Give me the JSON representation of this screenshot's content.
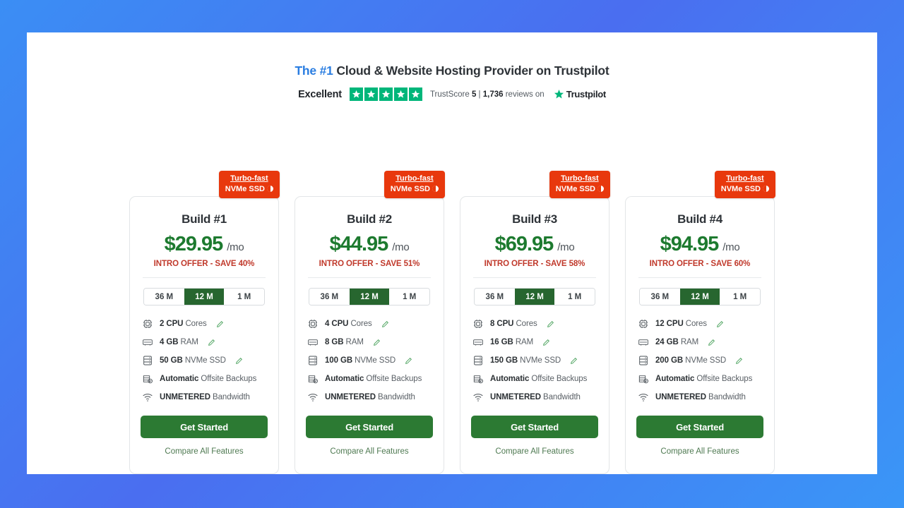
{
  "header": {
    "title_highlight": "The #1",
    "title_rest": " Cloud & Website Hosting Provider on Trustpilot",
    "rating_word": "Excellent",
    "stars": 5,
    "star_color": "#00b67a",
    "trustscore_prefix": "TrustScore ",
    "trustscore_value": "5",
    "separator": " | ",
    "reviews_count": "1,736",
    "reviews_suffix": " reviews on",
    "brand": "Trustpilot"
  },
  "badge": {
    "line1": "Turbo-fast",
    "line2": "NVMe SSD",
    "info_icon": "info-icon",
    "color": "#e8380d"
  },
  "terms": [
    "36 M",
    "12 M",
    "1 M"
  ],
  "selected_term": "12 M",
  "labels": {
    "per_month": "/mo",
    "cta": "Get Started",
    "compare": "Compare All Features"
  },
  "colors": {
    "price": "#1d7a2f",
    "intro": "#c0392b",
    "cta": "#2c7a33",
    "accent_blue": "#2a7de1"
  },
  "plans": [
    {
      "title": "Build #1",
      "price": "$29.95",
      "intro": "INTRO OFFER - SAVE 40%",
      "features": [
        {
          "icon": "cpu-icon",
          "strong": "2 CPU",
          "rest": " Cores",
          "editable": true
        },
        {
          "icon": "ram-icon",
          "strong": "4 GB",
          "rest": " RAM",
          "editable": true
        },
        {
          "icon": "ssd-icon",
          "strong": "50 GB",
          "rest": " NVMe SSD",
          "editable": true
        },
        {
          "icon": "backup-icon",
          "strong": "Automatic",
          "rest": " Offsite Backups",
          "editable": false
        },
        {
          "icon": "bandwidth-icon",
          "strong": "UNMETERED",
          "rest": " Bandwidth",
          "editable": false
        }
      ]
    },
    {
      "title": "Build #2",
      "price": "$44.95",
      "intro": "INTRO OFFER - SAVE 51%",
      "features": [
        {
          "icon": "cpu-icon",
          "strong": "4 CPU",
          "rest": " Cores",
          "editable": true
        },
        {
          "icon": "ram-icon",
          "strong": "8 GB",
          "rest": " RAM",
          "editable": true
        },
        {
          "icon": "ssd-icon",
          "strong": "100 GB",
          "rest": " NVMe SSD",
          "editable": true
        },
        {
          "icon": "backup-icon",
          "strong": "Automatic",
          "rest": " Offsite Backups",
          "editable": false
        },
        {
          "icon": "bandwidth-icon",
          "strong": "UNMETERED",
          "rest": " Bandwidth",
          "editable": false
        }
      ]
    },
    {
      "title": "Build #3",
      "price": "$69.95",
      "intro": "INTRO OFFER - SAVE 58%",
      "features": [
        {
          "icon": "cpu-icon",
          "strong": "8 CPU",
          "rest": " Cores",
          "editable": true
        },
        {
          "icon": "ram-icon",
          "strong": "16 GB",
          "rest": " RAM",
          "editable": true
        },
        {
          "icon": "ssd-icon",
          "strong": "150 GB",
          "rest": " NVMe SSD",
          "editable": true
        },
        {
          "icon": "backup-icon",
          "strong": "Automatic",
          "rest": " Offsite Backups",
          "editable": false
        },
        {
          "icon": "bandwidth-icon",
          "strong": "UNMETERED",
          "rest": " Bandwidth",
          "editable": false
        }
      ]
    },
    {
      "title": "Build #4",
      "price": "$94.95",
      "intro": "INTRO OFFER - SAVE 60%",
      "features": [
        {
          "icon": "cpu-icon",
          "strong": "12 CPU",
          "rest": " Cores",
          "editable": true
        },
        {
          "icon": "ram-icon",
          "strong": "24 GB",
          "rest": " RAM",
          "editable": true
        },
        {
          "icon": "ssd-icon",
          "strong": "200 GB",
          "rest": " NVMe SSD",
          "editable": true
        },
        {
          "icon": "backup-icon",
          "strong": "Automatic",
          "rest": " Offsite Backups",
          "editable": false
        },
        {
          "icon": "bandwidth-icon",
          "strong": "UNMETERED",
          "rest": " Bandwidth",
          "editable": false
        }
      ]
    }
  ]
}
